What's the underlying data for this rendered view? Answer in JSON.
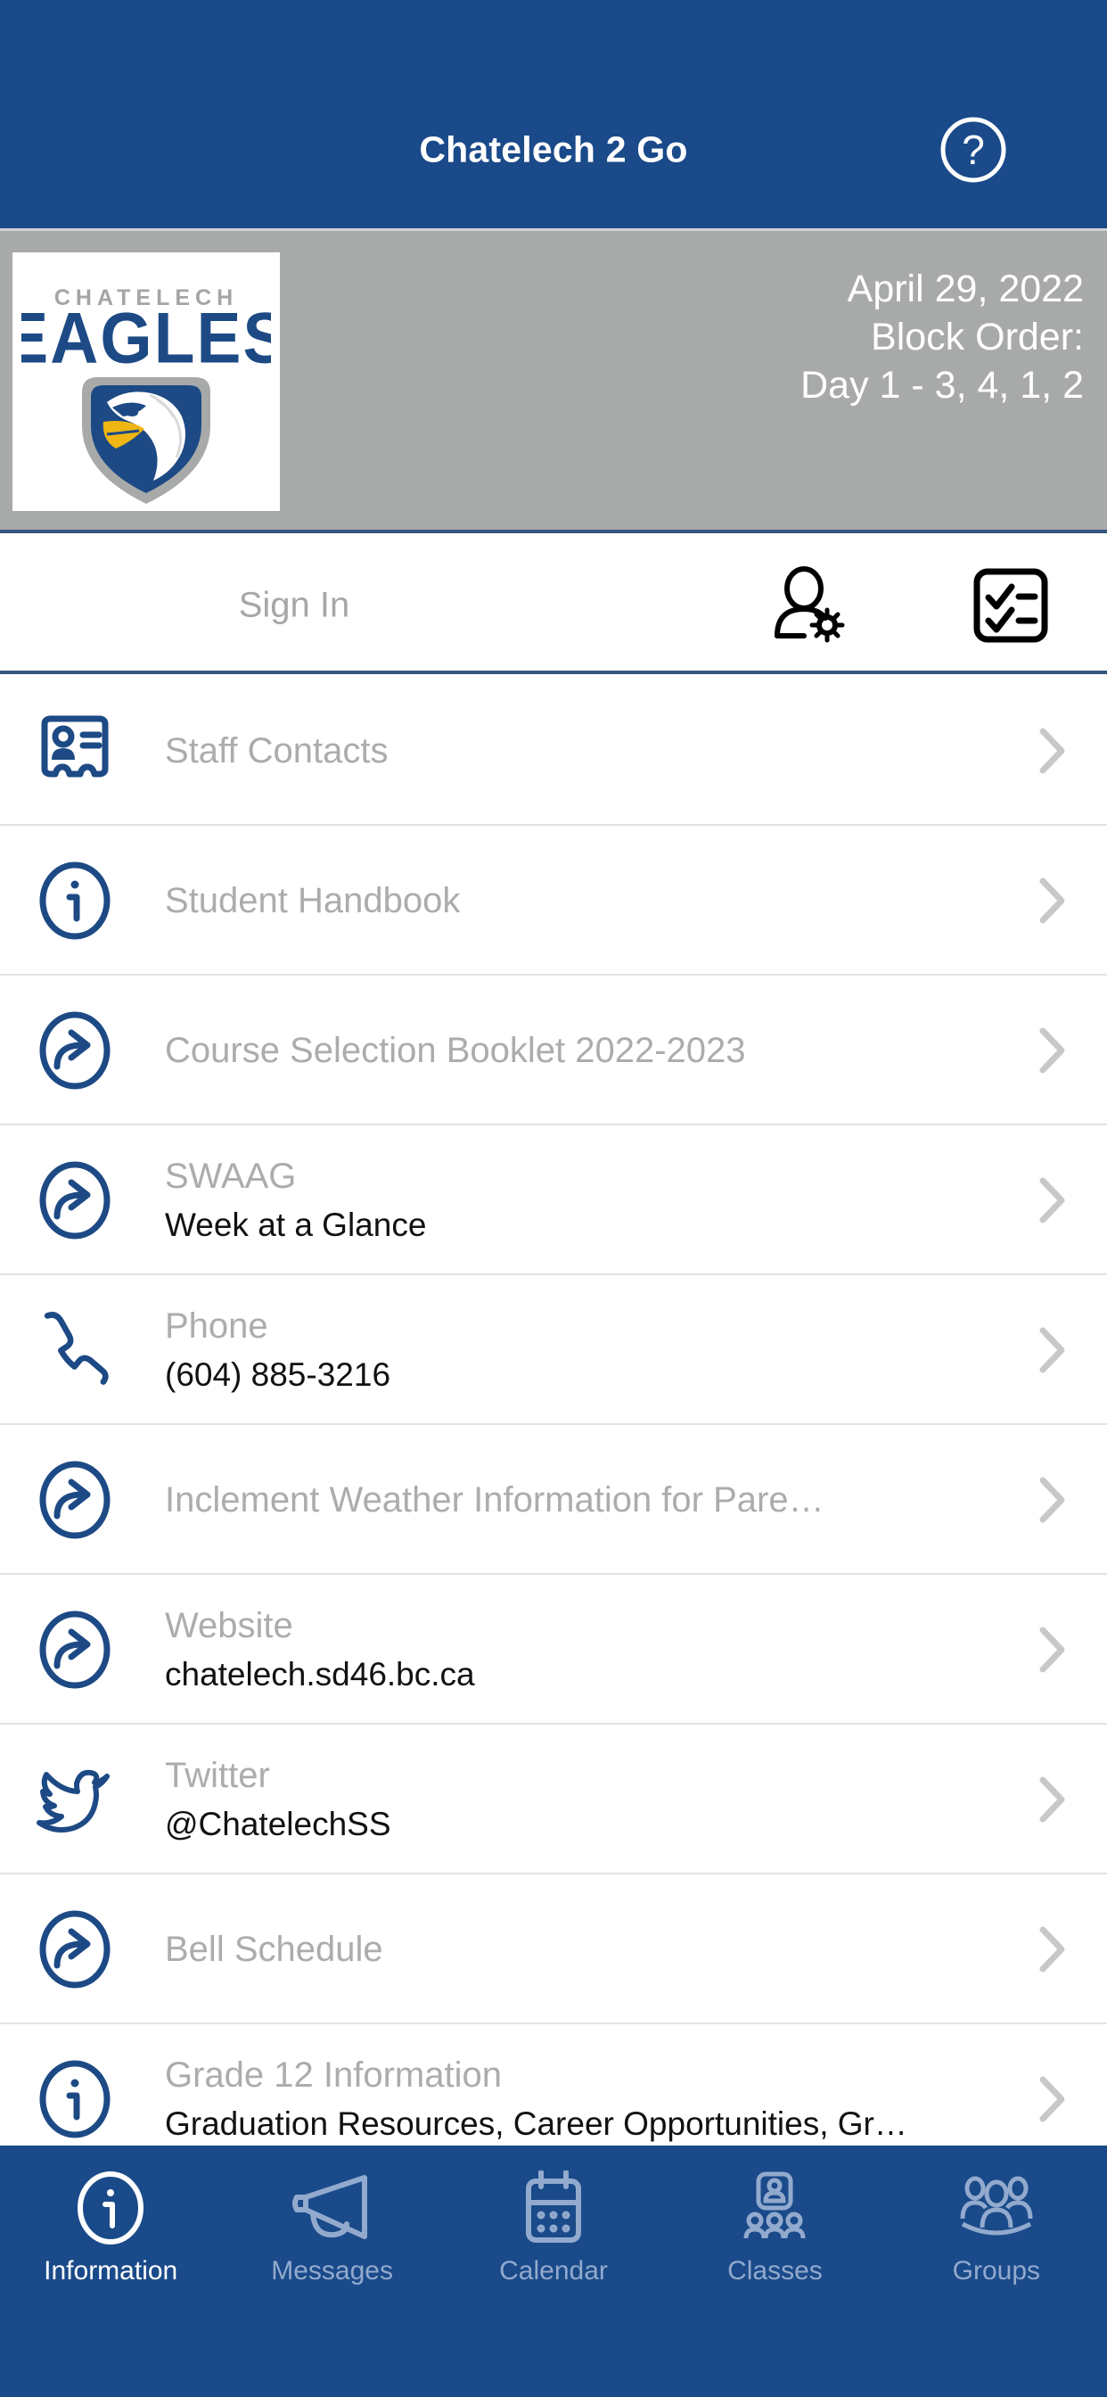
{
  "header": {
    "title": "Chatelech 2 Go",
    "help_icon": "help-circle-icon",
    "background_color": "#1a4a89"
  },
  "banner": {
    "logo_alt": "CHATELECH EAGLES",
    "logo_wordmark_top": "CHATELECH",
    "logo_wordmark_main": "EAGLES",
    "date": "April 29, 2022",
    "block_order_label": "Block Order:",
    "block_order_value": "Day 1 - 3, 4, 1, 2",
    "background_color": "#a8aaaa"
  },
  "signin": {
    "label": "Sign In",
    "account_icon": "user-settings-icon",
    "checklist_icon": "checklist-icon"
  },
  "list": {
    "items": [
      {
        "title": "Staff Contacts",
        "subtitle": "",
        "icon": "contact-card-icon"
      },
      {
        "title": "Student Handbook",
        "subtitle": "",
        "icon": "info-circle-icon"
      },
      {
        "title": "Course Selection Booklet 2022-2023",
        "subtitle": "",
        "icon": "external-link-icon"
      },
      {
        "title": "SWAAG",
        "subtitle": "Week at a Glance",
        "icon": "external-link-icon"
      },
      {
        "title": "Phone",
        "subtitle": "(604) 885-3216",
        "icon": "phone-icon"
      },
      {
        "title": "Inclement Weather Information for Pare…",
        "subtitle": "",
        "icon": "external-link-icon"
      },
      {
        "title": "Website",
        "subtitle": "chatelech.sd46.bc.ca",
        "icon": "external-link-icon"
      },
      {
        "title": "Twitter",
        "subtitle": "@ChatelechSS",
        "icon": "twitter-bird-icon"
      },
      {
        "title": "Bell Schedule",
        "subtitle": "",
        "icon": "external-link-icon"
      },
      {
        "title": "Grade 12 Information",
        "subtitle": "Graduation Resources, Career Opportunities, Gr…",
        "icon": "info-circle-icon"
      }
    ],
    "chevron_icon": "chevron-right-icon"
  },
  "tabbar": {
    "tabs": [
      {
        "label": "Information",
        "icon": "info-circle-icon",
        "active": true
      },
      {
        "label": "Messages",
        "icon": "megaphone-icon",
        "active": false
      },
      {
        "label": "Calendar",
        "icon": "calendar-icon",
        "active": false
      },
      {
        "label": "Classes",
        "icon": "classes-icon",
        "active": false
      },
      {
        "label": "Groups",
        "icon": "groups-icon",
        "active": false
      }
    ],
    "background_color": "#1a4a89",
    "active_color": "#ffffff",
    "inactive_color": "#92aace"
  },
  "colors": {
    "brand_blue": "#1a4a89",
    "icon_blue": "#1d4a85",
    "banner_gray": "#a8aaaa",
    "title_gray": "#aaacae",
    "subtitle_black": "#111111",
    "divider": "#e2e3e4",
    "logo_gold": "#efb512"
  }
}
